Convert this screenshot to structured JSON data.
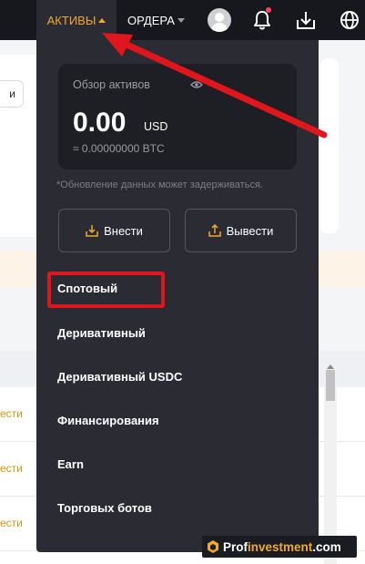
{
  "nav": {
    "assets_label": "АКТИВЫ",
    "orders_label": "ОРДЕРА",
    "icons": [
      "avatar",
      "bell-icon",
      "download-icon",
      "globe-icon"
    ],
    "active_color": "#f0a82e"
  },
  "background": {
    "partial_button_label": "и",
    "table_rows": [
      "ести",
      "ести",
      "ести"
    ],
    "notice_arrow": ">"
  },
  "dropdown": {
    "overview": {
      "title": "Обзор активов",
      "amount": "0.00",
      "currency": "USD",
      "btc_equivalent": "≈ 0.00000000 BTC"
    },
    "note": "*Обновление данных может задерживаться.",
    "deposit_label": "Внести",
    "withdraw_label": "Вывести",
    "menu_items": [
      {
        "label": "Спотовый",
        "highlighted": true
      },
      {
        "label": "Деривативный"
      },
      {
        "label": "Деривативный USDC"
      },
      {
        "label": "Финансирования"
      },
      {
        "label": "Earn"
      },
      {
        "label": "Торговых ботов"
      }
    ]
  },
  "annotation_color": "#e0161d",
  "watermark": {
    "prefix": "Prof",
    "highlight": "investment",
    "suffix": ".com"
  }
}
